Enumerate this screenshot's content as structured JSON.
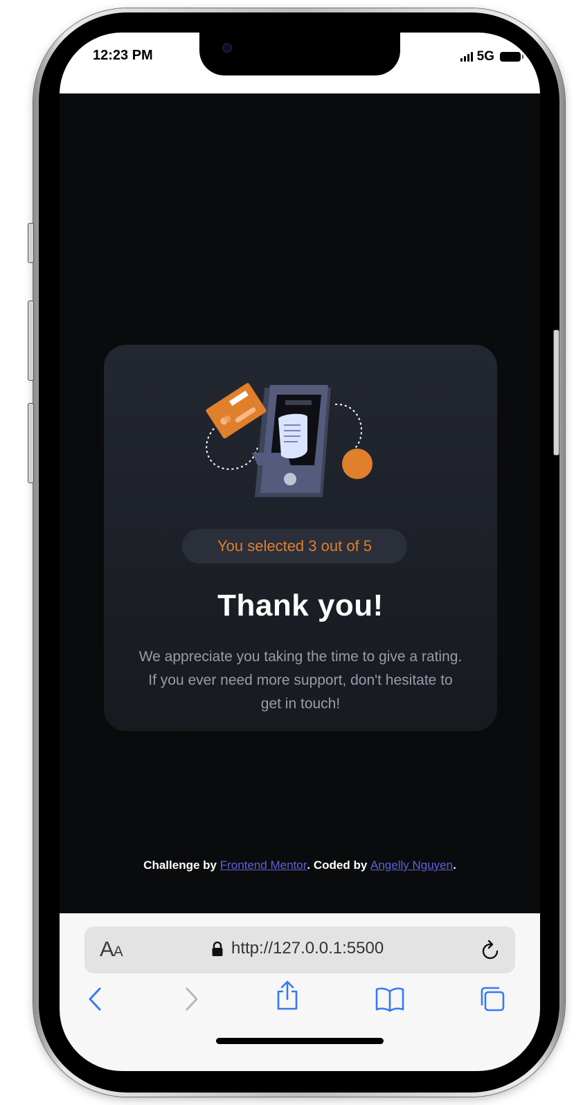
{
  "status_bar": {
    "time": "12:23 PM",
    "network": "5G"
  },
  "rating_card": {
    "selected_text": "You selected 3 out of 5",
    "title": "Thank you!",
    "description": "We appreciate you taking the time to give a rating. If you ever need more support, don't hesitate to get in touch!"
  },
  "attribution": {
    "prefix": "Challenge by ",
    "frontend_mentor": "Frontend Mentor",
    "middle": ". Coded by ",
    "author": "Angelly Nguyen",
    "suffix": "."
  },
  "safari": {
    "text_size_label": "A",
    "text_size_label_small": "A",
    "url": "http://127.0.0.1:5500"
  },
  "colors": {
    "accent": "#e07f2c",
    "card_bg": "#1f232b",
    "page_bg": "#0a0b0d",
    "muted_text": "#959eac",
    "link": "#5c63d8",
    "safari_blue": "#3478f6"
  },
  "icons": [
    "signal-bars-icon",
    "battery-icon",
    "lock-icon",
    "reload-icon",
    "back-icon",
    "forward-icon",
    "share-icon",
    "bookmarks-icon",
    "tabs-icon",
    "payment-illustration"
  ]
}
